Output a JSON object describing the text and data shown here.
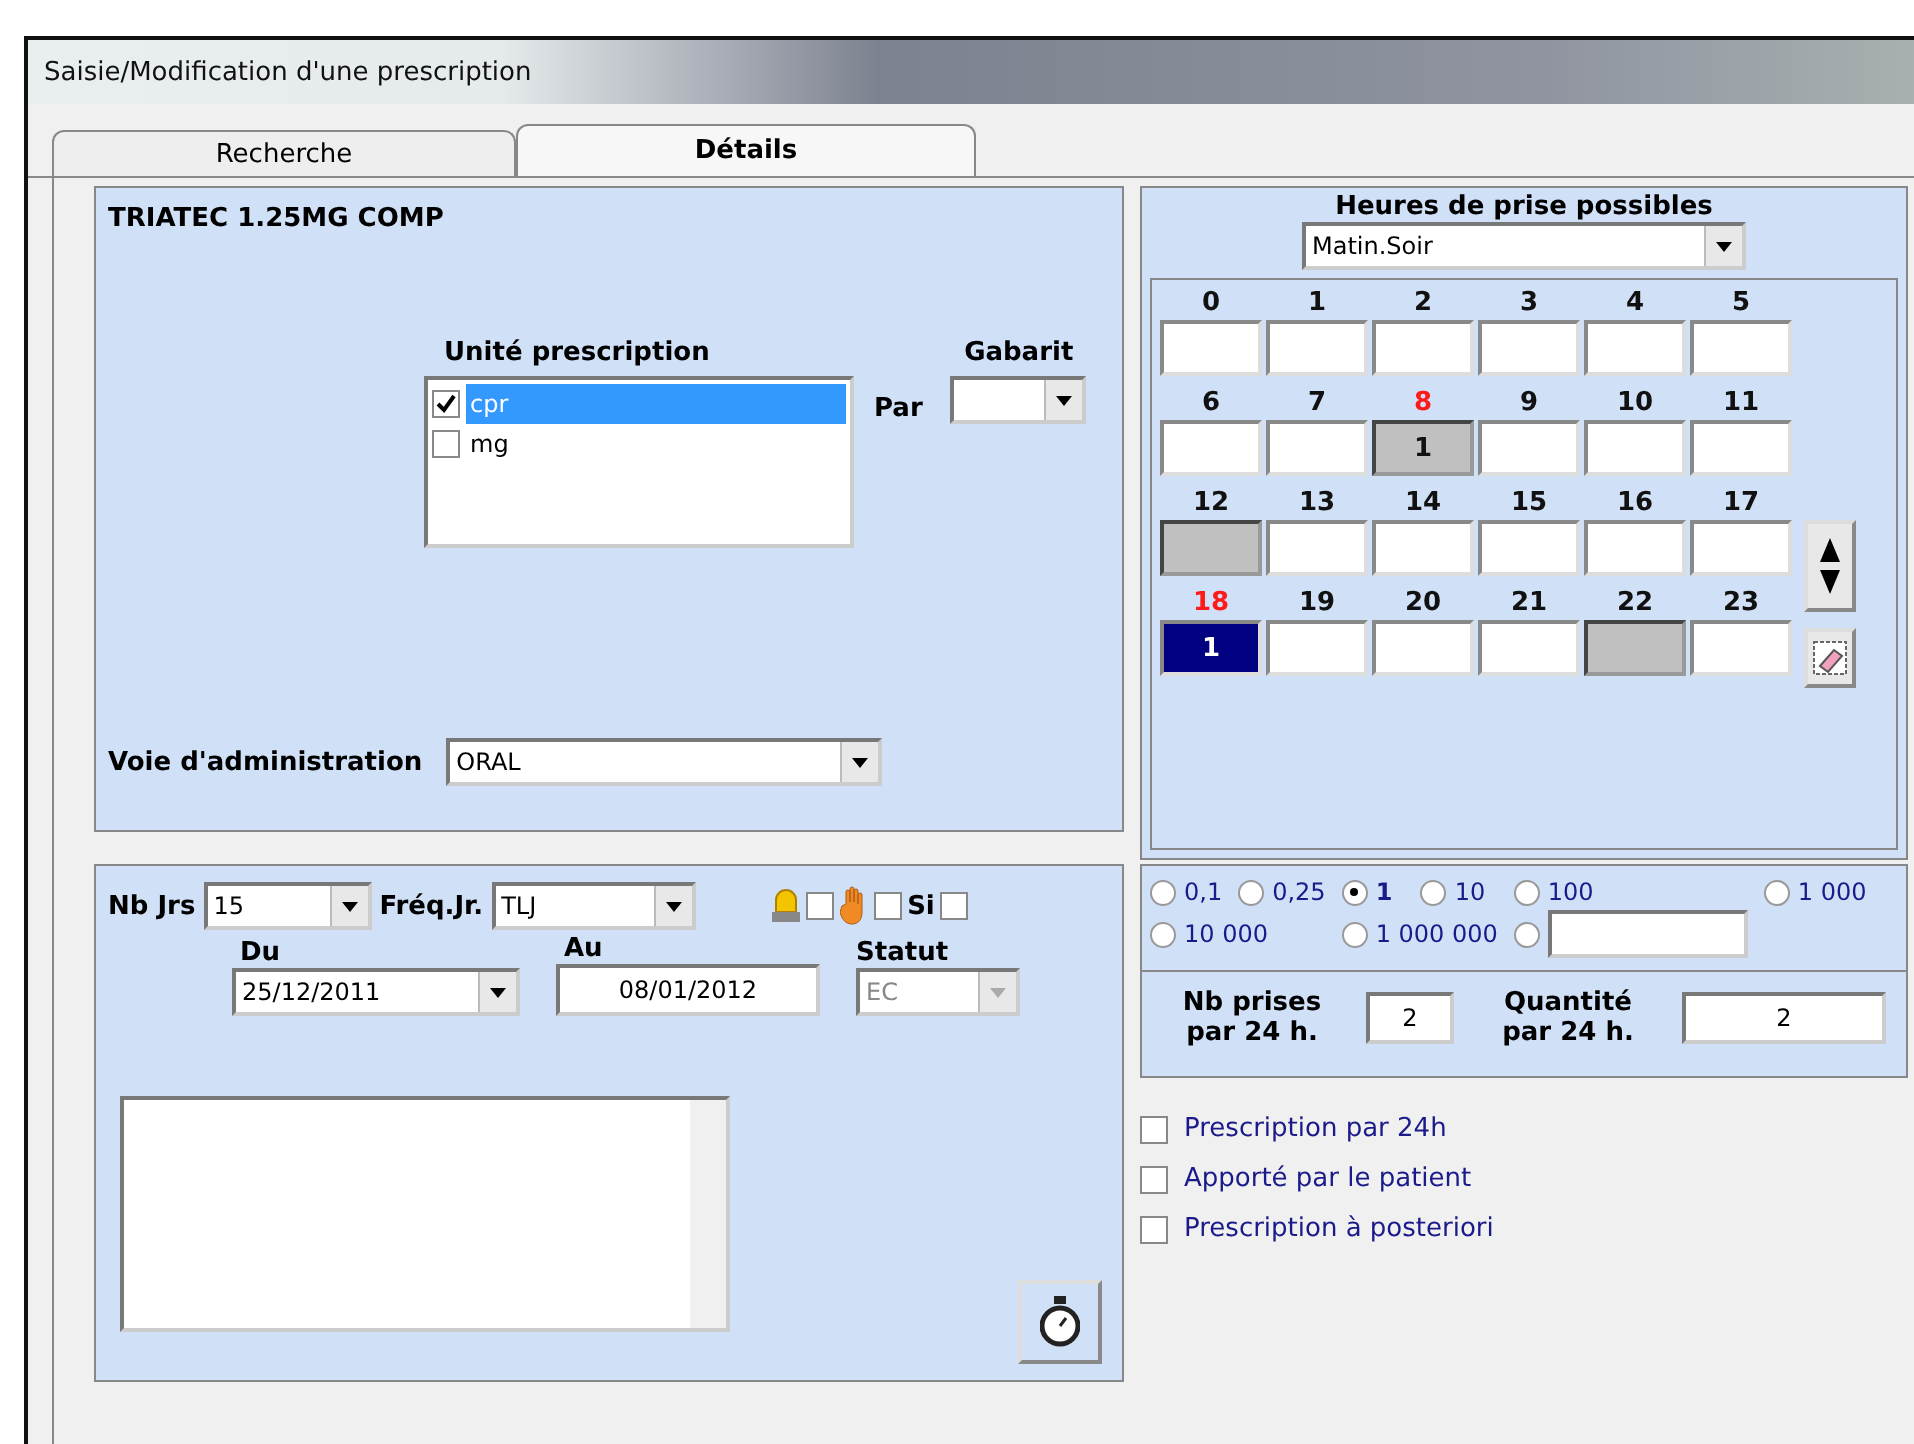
{
  "window": {
    "title": "Saisie/Modification d'une prescription"
  },
  "tabs": [
    {
      "label": "Recherche",
      "selected": false
    },
    {
      "label": "Détails",
      "selected": true
    }
  ],
  "product": "TRIATEC 1.25MG COMP",
  "unit": {
    "label": "Unité prescription",
    "items": [
      {
        "label": "cpr",
        "checked": true,
        "selected": true
      },
      {
        "label": "mg",
        "checked": false,
        "selected": false
      }
    ]
  },
  "par_label": "Par",
  "gabarit": {
    "label": "Gabarit"
  },
  "voie": {
    "label": "Voie d'administration",
    "value": "ORAL"
  },
  "nb_jrs": {
    "label": "Nb Jrs",
    "value": "15"
  },
  "freq": {
    "label": "Fréq.Jr.",
    "value": "TLJ"
  },
  "flags": [
    {
      "kind": "alarm",
      "checked": false
    },
    {
      "kind": "hand",
      "checked": false
    },
    {
      "kind": "text",
      "label": "Si",
      "checked": false
    }
  ],
  "du": {
    "label": "Du",
    "value": "25/12/2011"
  },
  "au": {
    "label": "Au",
    "value": "08/01/2012"
  },
  "statut": {
    "label": "Statut",
    "value": "EC",
    "disabled": true
  },
  "hours_panel": {
    "label": "Heures de prise possibles",
    "value": "Matin.Soir"
  },
  "hours": [
    {
      "label": "0",
      "shaded": false,
      "selected": false,
      "highlight": false
    },
    {
      "label": "1",
      "shaded": false,
      "selected": false,
      "highlight": false
    },
    {
      "label": "2",
      "shaded": false,
      "selected": false,
      "highlight": false
    },
    {
      "label": "3",
      "shaded": false,
      "selected": false,
      "highlight": false
    },
    {
      "label": "4",
      "shaded": false,
      "selected": false,
      "highlight": false
    },
    {
      "label": "5",
      "shaded": false,
      "selected": false,
      "highlight": false
    },
    {
      "label": "6",
      "shaded": false,
      "selected": false,
      "highlight": false
    },
    {
      "label": "7",
      "shaded": false,
      "selected": false,
      "highlight": false
    },
    {
      "label": "8",
      "value": "1",
      "shaded": true,
      "selected": false,
      "highlight": true
    },
    {
      "label": "9",
      "shaded": false,
      "selected": false,
      "highlight": false
    },
    {
      "label": "10",
      "shaded": false,
      "selected": false,
      "highlight": false
    },
    {
      "label": "11",
      "shaded": false,
      "selected": false,
      "highlight": false
    },
    {
      "label": "12",
      "shaded": true,
      "selected": false,
      "highlight": false
    },
    {
      "label": "13",
      "shaded": false,
      "selected": false,
      "highlight": false
    },
    {
      "label": "14",
      "shaded": false,
      "selected": false,
      "highlight": false
    },
    {
      "label": "15",
      "shaded": false,
      "selected": false,
      "highlight": false
    },
    {
      "label": "16",
      "shaded": false,
      "selected": false,
      "highlight": false
    },
    {
      "label": "17",
      "shaded": false,
      "selected": false,
      "highlight": false
    },
    {
      "label": "18",
      "value": "1",
      "shaded": false,
      "selected": true,
      "highlight": true
    },
    {
      "label": "19",
      "shaded": false,
      "selected": false,
      "highlight": false
    },
    {
      "label": "20",
      "shaded": false,
      "selected": false,
      "highlight": false
    },
    {
      "label": "21",
      "shaded": false,
      "selected": false,
      "highlight": false
    },
    {
      "label": "22",
      "shaded": true,
      "selected": false,
      "highlight": false
    },
    {
      "label": "23",
      "shaded": false,
      "selected": false,
      "highlight": false
    }
  ],
  "scales": [
    {
      "label": "0,1",
      "selected": false
    },
    {
      "label": "0,25",
      "selected": false
    },
    {
      "label": "1",
      "selected": true
    },
    {
      "label": "10",
      "selected": false
    },
    {
      "label": "100",
      "selected": false
    },
    {
      "label": "1 000",
      "selected": false
    },
    {
      "label": "10 000",
      "selected": false
    },
    {
      "label": "1 000 000",
      "selected": false
    },
    {
      "kind": "custom",
      "selected": false
    }
  ],
  "nb_prises": {
    "label": "Nb prises par 24 h.",
    "value": "2"
  },
  "quantite": {
    "label": "Quantité par 24 h.",
    "value": "2"
  },
  "options": [
    {
      "label": "Prescription par 24h",
      "checked": false
    },
    {
      "label": "Apporté par le patient",
      "checked": false
    },
    {
      "label": "Prescription à posteriori",
      "checked": false
    }
  ]
}
